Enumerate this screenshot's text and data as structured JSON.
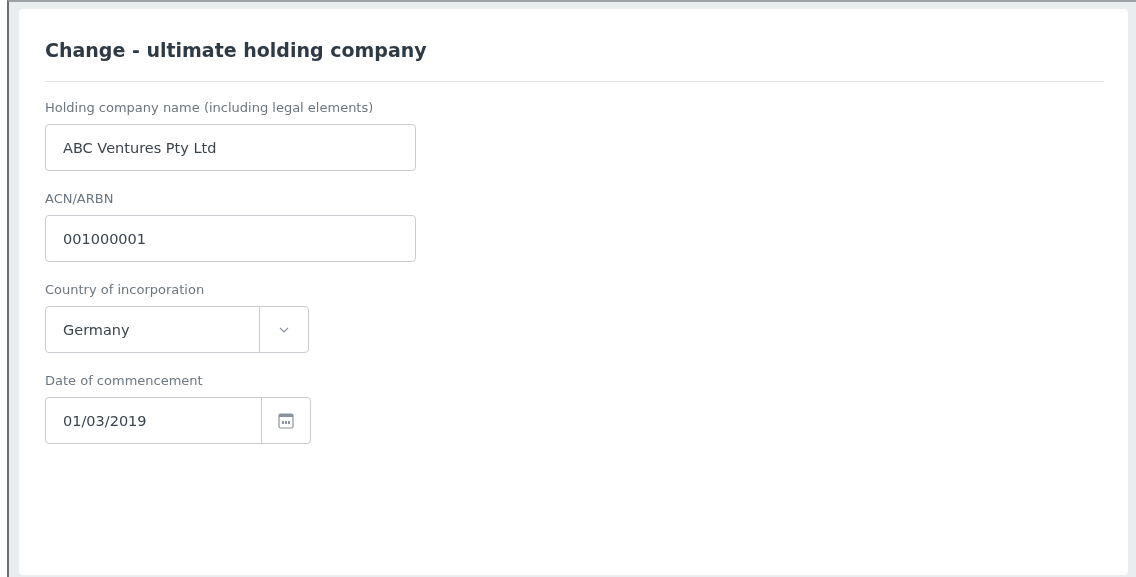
{
  "form": {
    "title": "Change - ultimate holding company",
    "fields": [
      {
        "kind": "text",
        "label": "Holding company name (including legal elements)",
        "value": "ABC Ventures Pty Ltd"
      },
      {
        "kind": "text",
        "label": "ACN/ARBN",
        "value": "001000001"
      },
      {
        "kind": "select",
        "label": "Country of incorporation",
        "value": "Germany"
      },
      {
        "kind": "date",
        "label": "Date of commencement",
        "value": "01/03/2019"
      }
    ]
  }
}
